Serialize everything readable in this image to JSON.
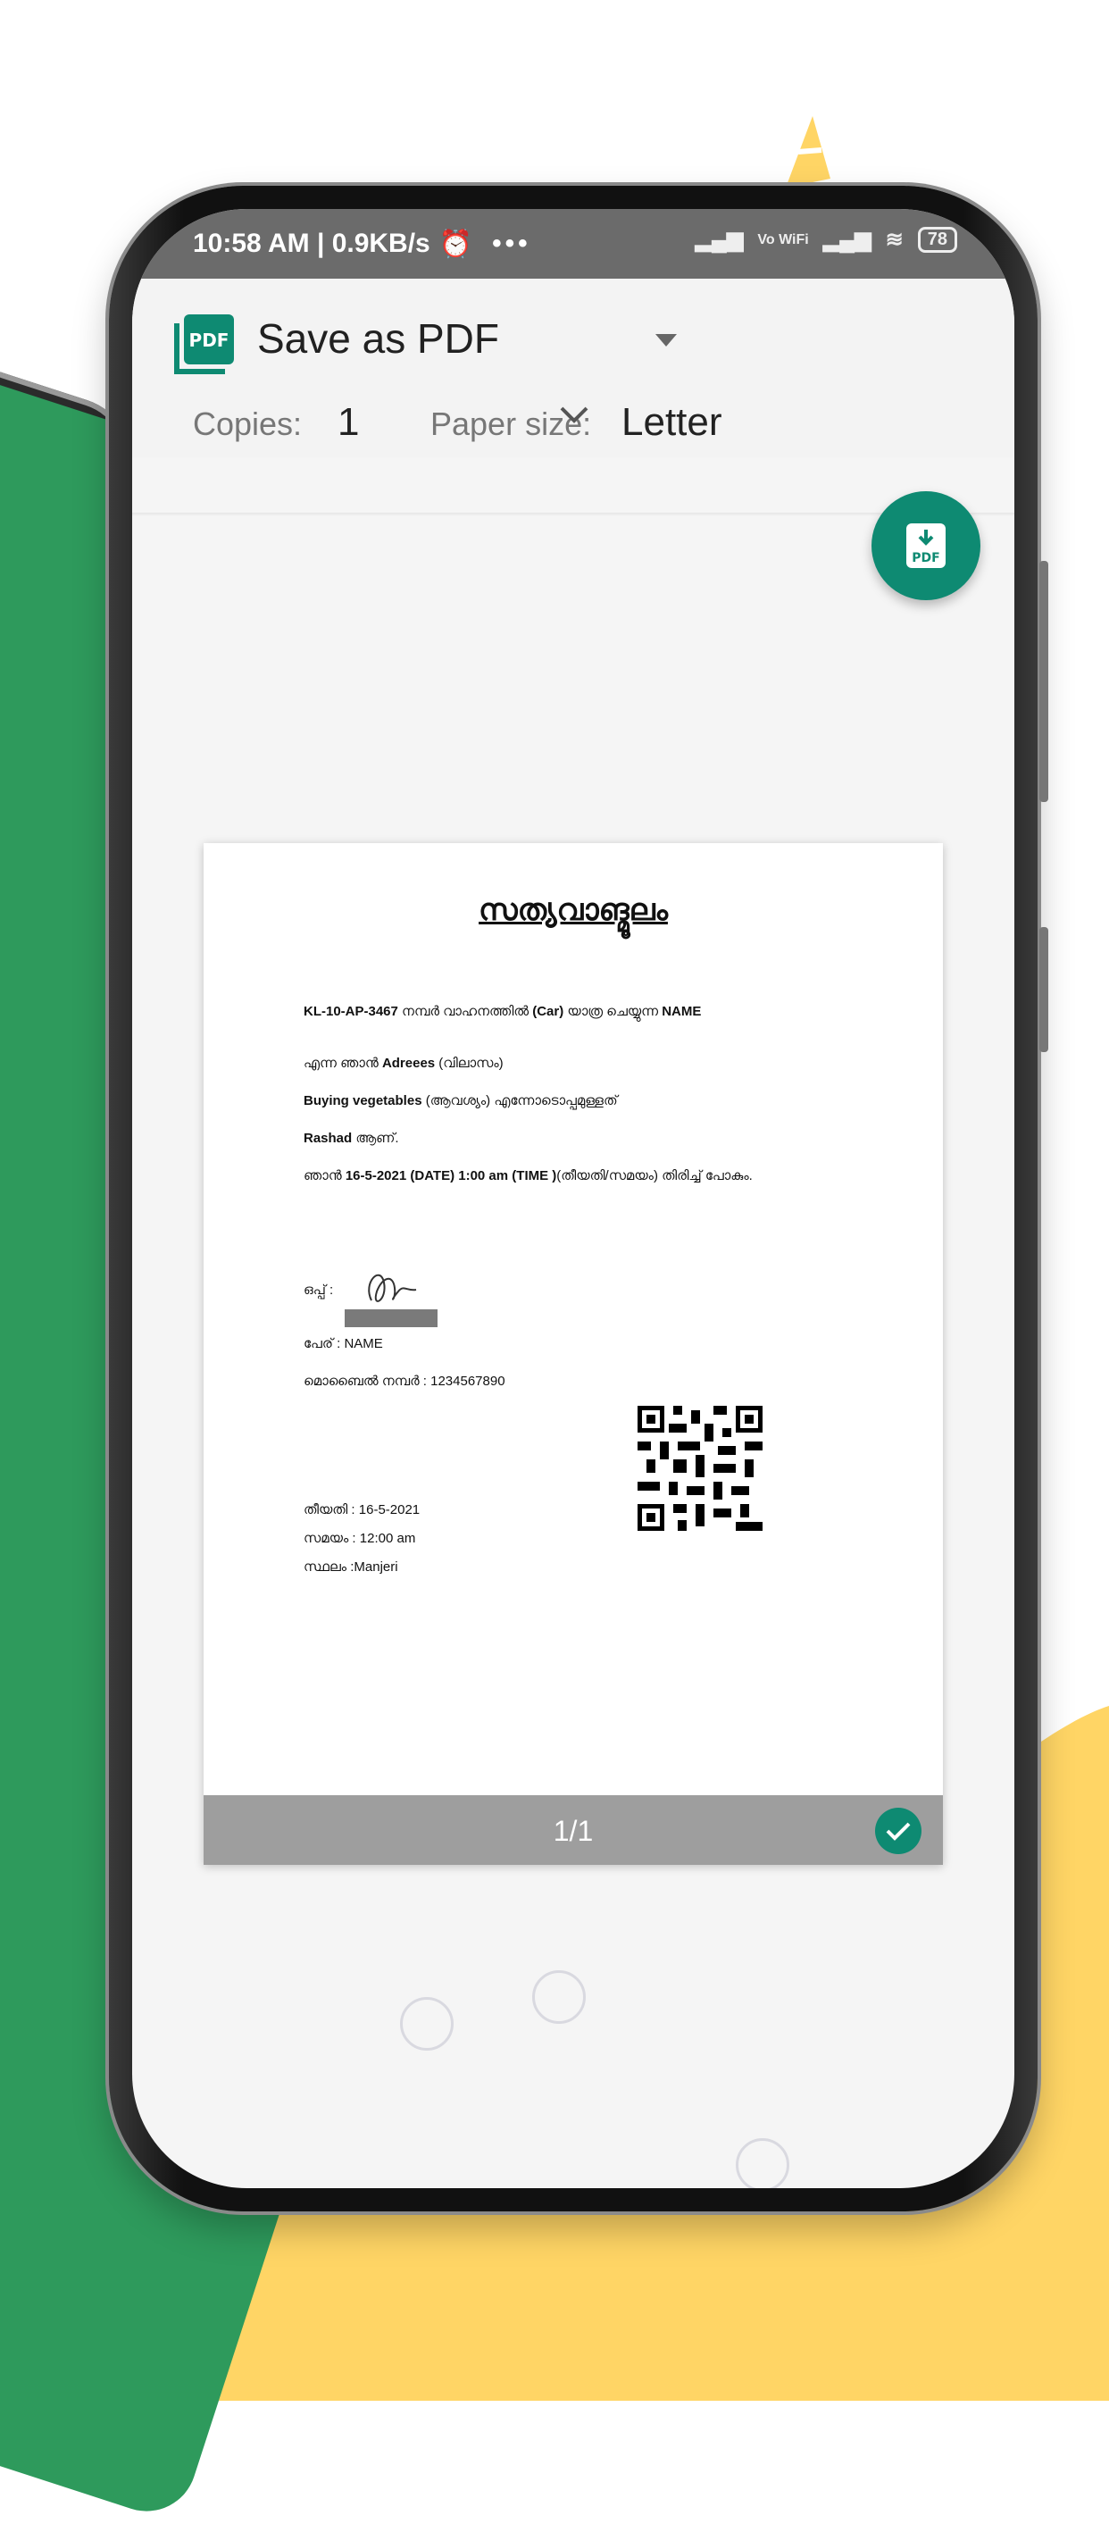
{
  "status": {
    "time": "10:58 AM",
    "speed": "0.9KB/s",
    "battery": "78",
    "wifi_label": "Vo WiFi"
  },
  "print": {
    "destination": "Save as PDF",
    "pdf_logo_text": "PDF",
    "copies_label": "Copies:",
    "copies_value": "1",
    "paper_label": "Paper size:",
    "paper_value": "Letter",
    "fab_text": "PDF"
  },
  "document": {
    "title": "സത്യവാങ്മൂലം",
    "line1": {
      "vehicle": "KL-10-AP-3467",
      "text1": " നമ്പർ വാഹനത്തിൽ ",
      "type": "(Car)",
      "text2": " യാത്ര ചെയ്യുന്ന ",
      "name": "NAME"
    },
    "line2": {
      "text1": "എന്ന ഞാൻ ",
      "addr": "Adreees",
      "text2": " (വിലാസം)"
    },
    "line3": {
      "purpose": "Buying vegetables",
      "text": " (ആവശ്യം) എന്നോടൊപ്പമുള്ളത്"
    },
    "line4": {
      "person": "Rashad",
      "text": " ആണ്."
    },
    "line5": {
      "text1": "ഞാൻ ",
      "datetime": "16-5-2021 (DATE) 1:00 am (TIME )",
      "text2": "(തീയതി/സമയം) തിരിച്ച് പോകും."
    },
    "sign_label": "ഒപ്പ് :",
    "name_line": "പേര് : NAME",
    "mobile_line": "മൊബൈൽ നമ്പർ : 1234567890",
    "date_line": "തീയതി : 16-5-2021",
    "time_line": "സമയം : 12:00 am",
    "place_line": "സ്ഥലം :Manjeri"
  },
  "pager": {
    "label": "1/1"
  },
  "colors": {
    "accent": "#0e8a72",
    "yellow": "#ffd565",
    "statusbar": "#6b6b6b"
  },
  "icons": [
    "pdf-icon",
    "dropdown-caret-icon",
    "chevron-down-icon",
    "download-pdf-icon",
    "check-icon",
    "alarm-icon",
    "signal-icon",
    "wifi-icon",
    "battery-icon"
  ]
}
